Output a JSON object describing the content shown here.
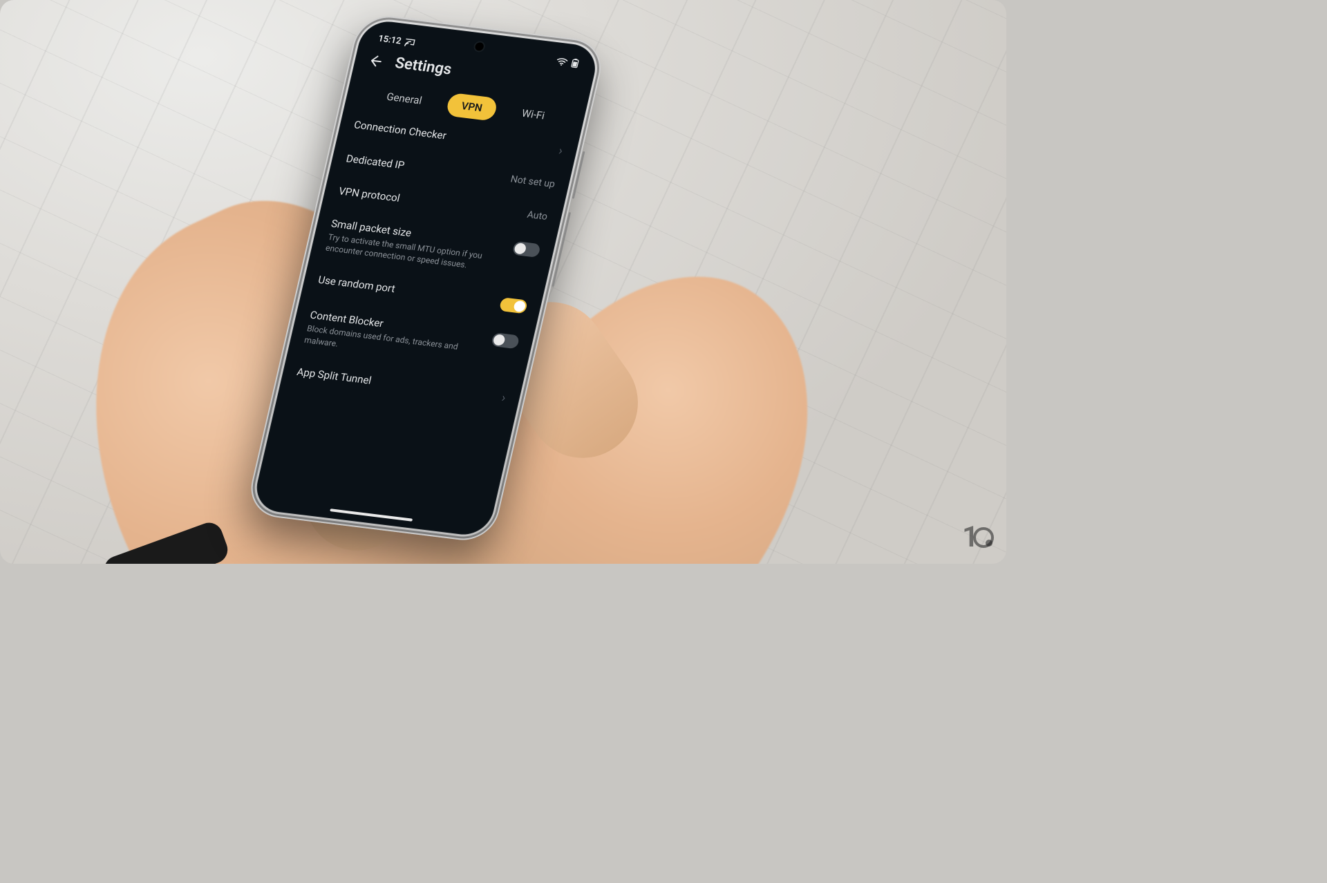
{
  "status": {
    "time": "15:12"
  },
  "header": {
    "title": "Settings"
  },
  "tabs": {
    "items": [
      {
        "label": "General"
      },
      {
        "label": "VPN"
      },
      {
        "label": "Wi-Fi"
      }
    ],
    "active_index": 1
  },
  "settings": {
    "connection_checker": {
      "label": "Connection Checker"
    },
    "dedicated_ip": {
      "label": "Dedicated IP",
      "value": "Not set up"
    },
    "vpn_protocol": {
      "label": "VPN protocol",
      "value": "Auto"
    },
    "small_packet": {
      "label": "Small packet size",
      "desc": "Try to activate the small MTU option if you encounter connection or speed issues.",
      "on": false
    },
    "random_port": {
      "label": "Use random port",
      "on": true
    },
    "content_blocker": {
      "label": "Content Blocker",
      "desc": "Block domains used for ads, trackers and malware.",
      "on": false
    },
    "split_tunnel": {
      "label": "App Split Tunnel"
    }
  },
  "watermark": {
    "digit": "1"
  },
  "colors": {
    "accent": "#f2c23a",
    "screen_bg": "#0a1117"
  }
}
